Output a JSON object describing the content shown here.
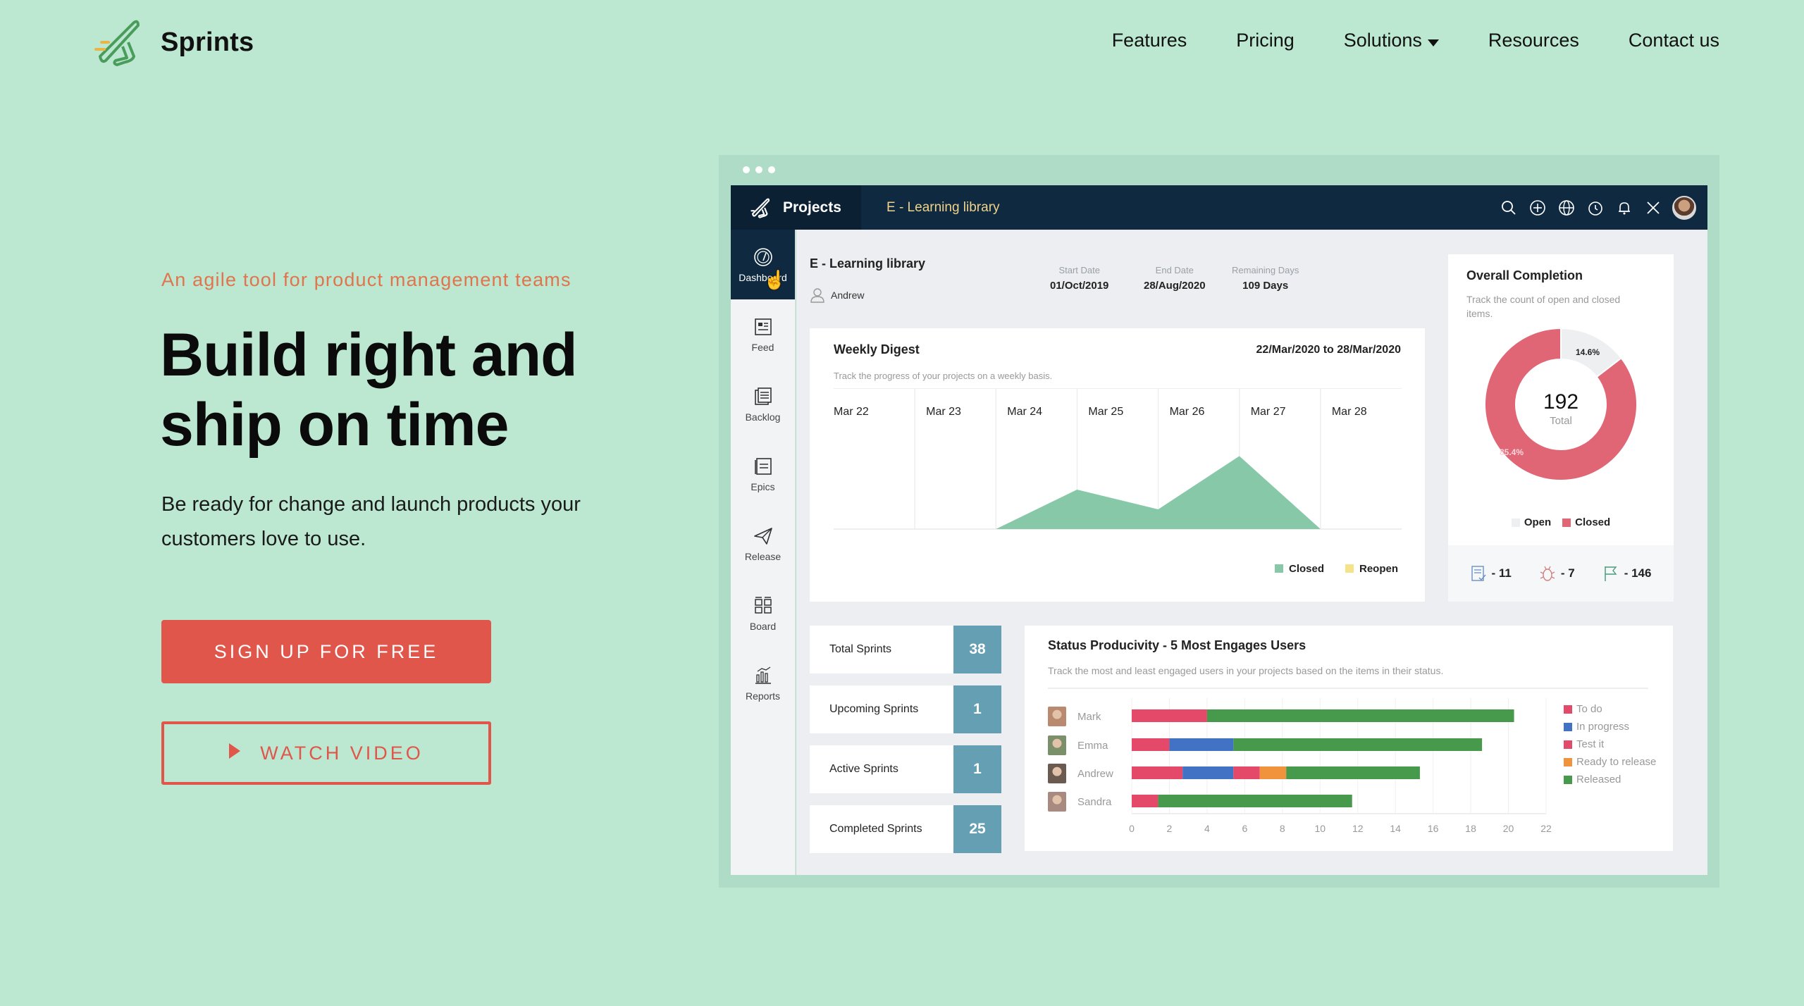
{
  "brand": {
    "name": "Sprints"
  },
  "nav": [
    {
      "label": "Features"
    },
    {
      "label": "Pricing"
    },
    {
      "label": "Solutions",
      "dropdown": true
    },
    {
      "label": "Resources"
    },
    {
      "label": "Contact us"
    }
  ],
  "hero": {
    "tagline": "An agile tool for product management teams",
    "headline_line1": "Build right and",
    "headline_line2": "ship on time",
    "subtext": "Be ready for change and launch products your customers love to use.",
    "signup_label": "SIGN UP FOR FREE",
    "video_label": "WATCH VIDEO"
  },
  "colors": {
    "background": "#bce8d2",
    "accent": "#e0564a",
    "tagline": "#e0744d",
    "appbar": "#0f2a40",
    "stat_box": "#659fb4",
    "area_closed": "#86c8a8",
    "area_reopen": "#f5e38a",
    "donut_closed": "#e06575",
    "donut_open": "#eeeff1",
    "todo": "#e5496a",
    "in_progress": "#4272c4",
    "test_it": "#e5496a",
    "ready_to_release": "#f0933c",
    "released": "#479a4b"
  },
  "app": {
    "projects_label": "Projects",
    "project_name": "E - Learning library",
    "top_icons": [
      "search-icon",
      "add-icon",
      "globe-icon",
      "clock-icon",
      "bell-icon",
      "tools-icon",
      "user-avatar"
    ],
    "sidebar": [
      {
        "label": "Dashboard",
        "icon": "dashboard-icon",
        "active": true
      },
      {
        "label": "Feed",
        "icon": "feed-icon"
      },
      {
        "label": "Backlog",
        "icon": "backlog-icon"
      },
      {
        "label": "Epics",
        "icon": "epics-icon"
      },
      {
        "label": "Release",
        "icon": "release-icon"
      },
      {
        "label": "Board",
        "icon": "board-icon"
      },
      {
        "label": "Reports",
        "icon": "reports-icon"
      }
    ],
    "project": {
      "title": "E - Learning library",
      "owner": "Andrew",
      "start_date_label": "Start Date",
      "start_date": "01/Oct/2019",
      "end_date_label": "End Date",
      "end_date": "28/Aug/2020",
      "remaining_label": "Remaining Days",
      "remaining": "109 Days"
    },
    "weekly_digest": {
      "title": "Weekly Digest",
      "range": "22/Mar/2020 to 28/Mar/2020",
      "subtitle": "Track the progress of your projects on a weekly basis.",
      "legend_closed": "Closed",
      "legend_reopen": "Reopen"
    },
    "overall_completion": {
      "title": "Overall Completion",
      "subtitle": "Track the count of open and closed items.",
      "total": "192",
      "total_label": "Total",
      "open_pct_label": "14.6%",
      "closed_pct_label": "85.4%",
      "legend_open": "Open",
      "legend_closed": "Closed",
      "footer": [
        {
          "icon": "task-icon",
          "value": "- 11"
        },
        {
          "icon": "bug-icon",
          "value": "- 7"
        },
        {
          "icon": "milestone-flag-icon",
          "value": "- 146"
        }
      ]
    },
    "sprints": [
      {
        "label": "Total Sprints",
        "value": "38"
      },
      {
        "label": "Upcoming Sprints",
        "value": "1"
      },
      {
        "label": "Active Sprints",
        "value": "1"
      },
      {
        "label": "Completed Sprints",
        "value": "25"
      }
    ],
    "status_productivity": {
      "title": "Status Producivity - 5 Most Engages Users",
      "subtitle": "Track the most and least engaged users in your projects based on the items in their status."
    }
  },
  "chart_data": [
    {
      "type": "area",
      "title": "Weekly Digest",
      "categories": [
        "Mar 22",
        "Mar 23",
        "Mar 24",
        "Mar 25",
        "Mar 26",
        "Mar 27",
        "Mar 28"
      ],
      "series": [
        {
          "name": "Closed",
          "values": [
            0,
            0,
            0,
            2,
            1,
            3.7,
            0
          ]
        },
        {
          "name": "Reopen",
          "values": [
            0,
            0,
            0,
            0,
            0,
            0,
            0
          ]
        }
      ],
      "ylim": [
        0,
        5
      ],
      "legend": "bottom-right",
      "grid": true
    },
    {
      "type": "pie",
      "title": "Overall Completion",
      "donut": true,
      "center_value": 192,
      "slices": [
        {
          "name": "Open",
          "value": 14.6
        },
        {
          "name": "Closed",
          "value": 85.4
        }
      ],
      "legend": "bottom"
    },
    {
      "type": "bar",
      "orientation": "horizontal",
      "stacked": true,
      "title": "Status Producivity - 5 Most Engages Users",
      "categories": [
        "Mark",
        "Emma",
        "Andrew",
        "Sandra"
      ],
      "series": [
        {
          "name": "To do",
          "values": [
            4,
            2,
            2.7,
            1.4
          ]
        },
        {
          "name": "In progress",
          "values": [
            0,
            3.4,
            2.7,
            0
          ]
        },
        {
          "name": "Test it",
          "values": [
            0,
            0,
            1.4,
            0
          ]
        },
        {
          "name": "Ready to release",
          "values": [
            0,
            0,
            1.4,
            0
          ]
        },
        {
          "name": "Released",
          "values": [
            16.3,
            13.2,
            7.1,
            10.3
          ]
        }
      ],
      "xticks": [
        0,
        2,
        4,
        6,
        8,
        10,
        12,
        14,
        16,
        18,
        20,
        22
      ],
      "xlim": [
        0,
        22
      ],
      "legend": "right",
      "grid": true
    }
  ]
}
